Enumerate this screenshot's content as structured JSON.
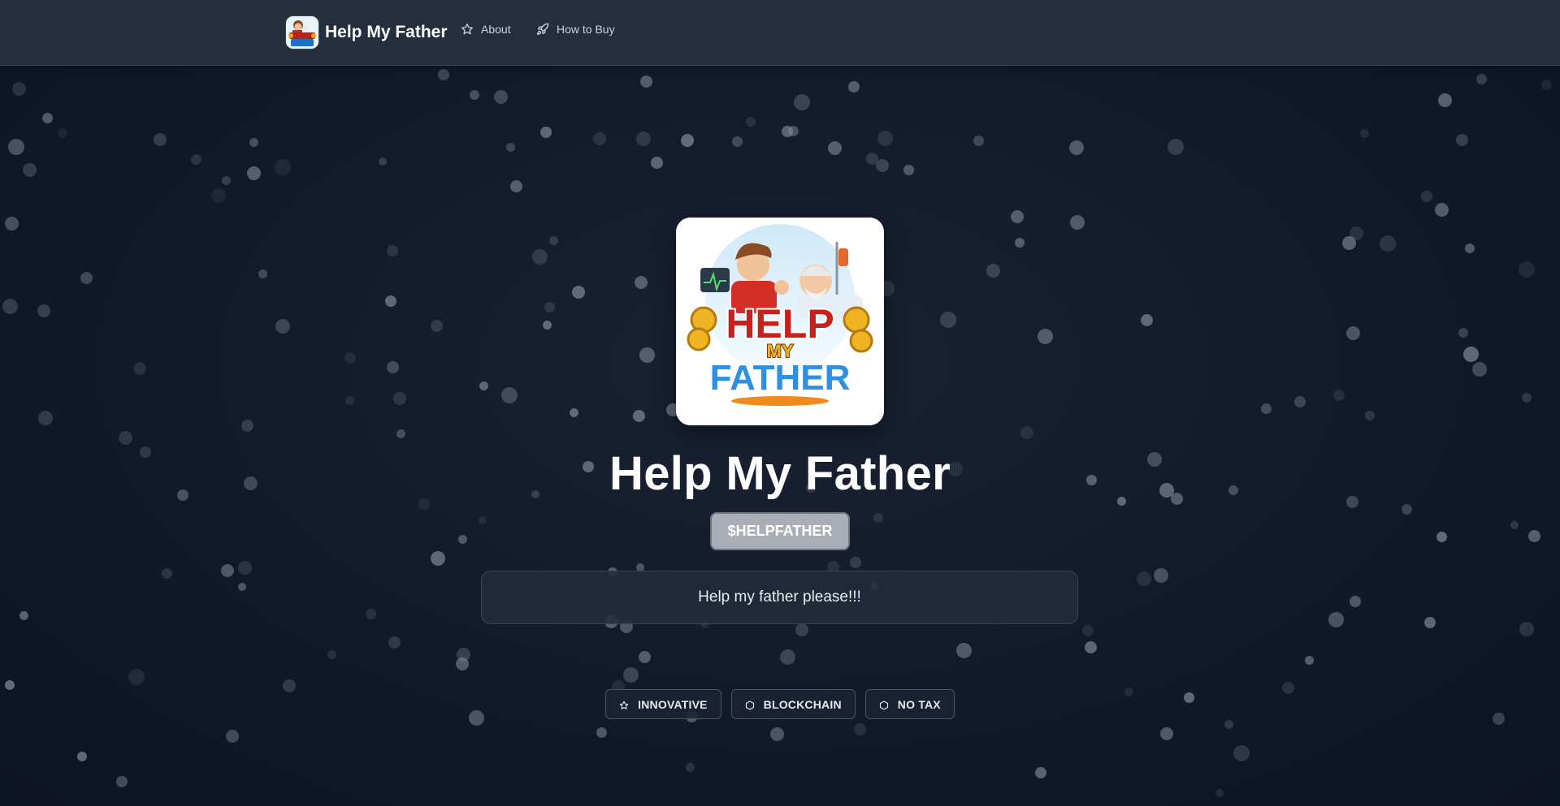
{
  "brand": {
    "name": "Help My Father"
  },
  "nav": {
    "about_label": "About",
    "about_icon": "star-icon",
    "howto_label": "How to Buy",
    "howto_icon": "rocket-icon"
  },
  "hero": {
    "logo_text_top": "HELP",
    "logo_text_mid": "MY",
    "logo_text_bottom": "FATHER",
    "title": "Help My Father",
    "ticker": "$HELPFATHER",
    "tagline": "Help my father please!!!"
  },
  "badges": [
    {
      "label": "INNOVATIVE",
      "icon": "star-icon"
    },
    {
      "label": "BLOCKCHAIN",
      "icon": "hexagon-icon"
    },
    {
      "label": "NO TAX",
      "icon": "hexagon-icon"
    }
  ],
  "colors": {
    "background": "#121a2a",
    "navbar": "#252e3d",
    "ticker_bg": "#a8adb6",
    "dot": "#8b93a3"
  }
}
